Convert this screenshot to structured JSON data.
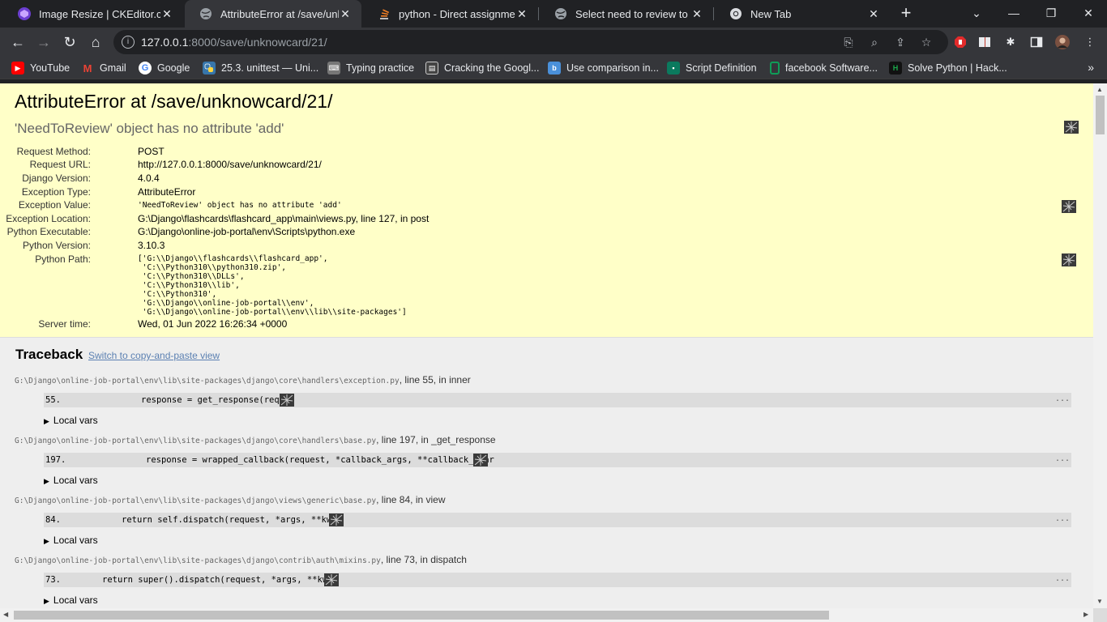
{
  "browser": {
    "tabs": [
      {
        "title": "Image Resize | CKEditor.com",
        "icon": "ckeditor-icon",
        "color": "#6c3fd1"
      },
      {
        "title": "AttributeError at /save/unknc",
        "icon": "globe-icon",
        "color": "#9aa0a6"
      },
      {
        "title": "python - Direct assignment t",
        "icon": "stackoverflow-icon",
        "color": "#f48024"
      },
      {
        "title": "Select need to review to char",
        "icon": "globe-icon",
        "color": "#9aa0a6"
      },
      {
        "title": "New Tab",
        "icon": "chrome-icon",
        "color": "#9aa0a6"
      }
    ],
    "url_host": "127.0.0.1",
    "url_path": ":8000/save/unknowcard/21/",
    "bookmarks": [
      {
        "label": "YouTube",
        "color": "#ff0000"
      },
      {
        "label": "Gmail",
        "color": "#ea4335"
      },
      {
        "label": "Google",
        "color": "#4285f4"
      },
      {
        "label": "25.3. unittest — Uni...",
        "color": "#3776ab"
      },
      {
        "label": "Typing practice",
        "color": "#777777"
      },
      {
        "label": "Cracking the Googl...",
        "color": "#555555"
      },
      {
        "label": "Use comparison in...",
        "color": "#4a90d9"
      },
      {
        "label": "Script Definition",
        "color": "#0b7a5e"
      },
      {
        "label": "facebook Software...",
        "color": "#0f9d58"
      },
      {
        "label": "Solve Python | Hack...",
        "color": "#1ba94c"
      }
    ]
  },
  "error": {
    "title": "AttributeError at /save/unknowcard/21/",
    "subtitle": "'NeedToReview' object has no attribute 'add'",
    "meta": [
      {
        "key": "Request Method:",
        "value": "POST"
      },
      {
        "key": "Request URL:",
        "value": "http://127.0.0.1:8000/save/unknowcard/21/"
      },
      {
        "key": "Django Version:",
        "value": "4.0.4"
      },
      {
        "key": "Exception Type:",
        "value": "AttributeError"
      },
      {
        "key": "Exception Value:",
        "value": "'NeedToReview' object has no attribute 'add'"
      },
      {
        "key": "Exception Location:",
        "value": "G:\\Django\\flashcards\\flashcard_app\\main\\views.py, line 127, in post"
      },
      {
        "key": "Python Executable:",
        "value": "G:\\Django\\online-job-portal\\env\\Scripts\\python.exe"
      },
      {
        "key": "Python Version:",
        "value": "3.10.3"
      },
      {
        "key": "Python Path:",
        "value": "['G:\\\\Django\\\\flashcards\\\\flashcard_app',\n 'C:\\\\Python310\\\\python310.zip',\n 'C:\\\\Python310\\\\DLLs',\n 'C:\\\\Python310\\\\lib',\n 'C:\\\\Python310',\n 'G:\\\\Django\\\\online-job-portal\\\\env',\n 'G:\\\\Django\\\\online-job-portal\\\\env\\\\lib\\\\site-packages']"
      },
      {
        "key": "Server time:",
        "value": "Wed, 01 Jun 2022 16:26:34 +0000"
      }
    ]
  },
  "traceback": {
    "heading": "Traceback",
    "switch_link": "Switch to copy-and-paste view",
    "locals_label": "Local vars",
    "frames": [
      {
        "path": "G:\\Django\\online-job-portal\\env\\lib\\site-packages\\django\\core\\handlers\\exception.py",
        "rest": ", line 55, in inner",
        "lineno": "55.",
        "code": "response = get_response(reque"
      },
      {
        "path": "G:\\Django\\online-job-portal\\env\\lib\\site-packages\\django\\core\\handlers\\base.py",
        "rest": ", line 197, in _get_response",
        "lineno": "197.",
        "code": "response = wrapped_callback(request, *callback_args, **callback_kwar"
      },
      {
        "path": "G:\\Django\\online-job-portal\\env\\lib\\site-packages\\django\\views\\generic\\base.py",
        "rest": ", line 84, in view",
        "lineno": "84.",
        "code": "return self.dispatch(request, *args, **kwar"
      },
      {
        "path": "G:\\Django\\online-job-portal\\env\\lib\\site-packages\\django\\contrib\\auth\\mixins.py",
        "rest": ", line 73, in dispatch",
        "lineno": "73.",
        "code": "return super().dispatch(request, *args, **kwar"
      }
    ],
    "ellipsis": "..."
  }
}
